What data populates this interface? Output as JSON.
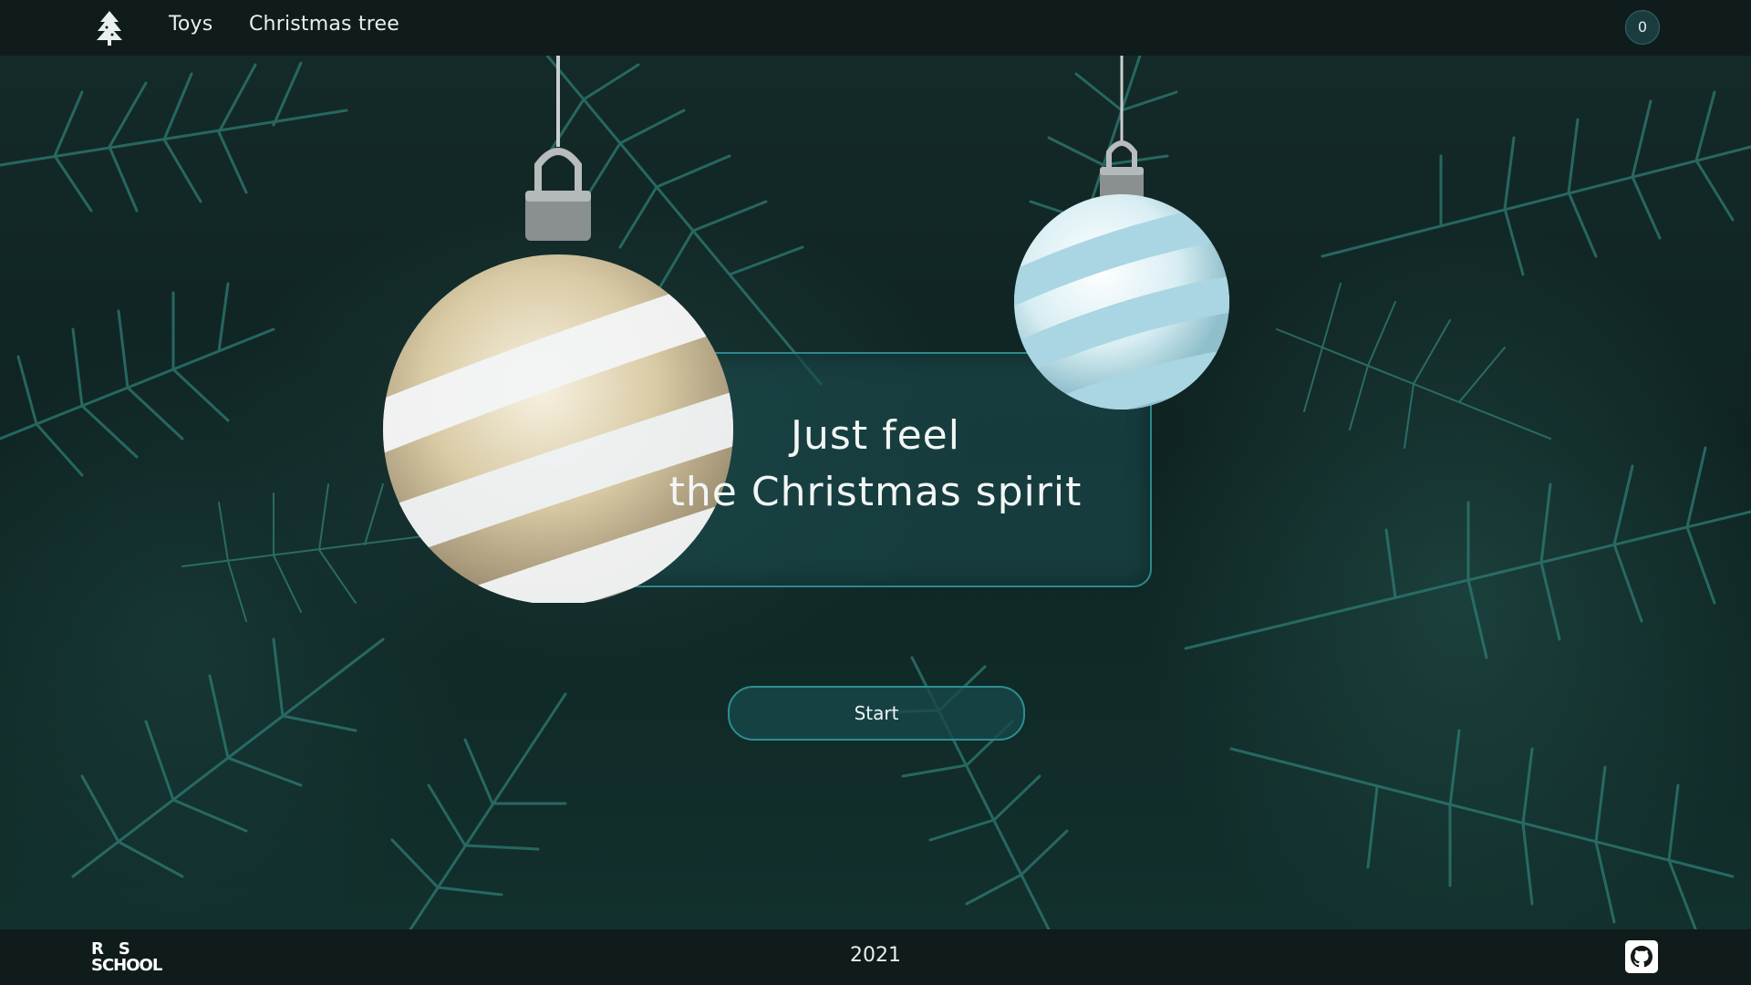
{
  "header": {
    "logo_icon": "christmas-tree-icon",
    "nav": [
      {
        "label": "Toys"
      },
      {
        "label": "Christmas tree"
      }
    ],
    "favorites_count": "0"
  },
  "hero": {
    "line1": "Just feel",
    "line2": "the Christmas spirit",
    "start_label": "Start"
  },
  "footer": {
    "rs_logo_top": "RS",
    "rs_logo_bottom": "SCHOOL",
    "year": "2021",
    "github_icon": "github-icon"
  },
  "colors": {
    "header_bg": "#0f1c1b",
    "accent_border": "#2b8a8c",
    "card_bg": "#1c4b4e",
    "text": "#f2f6f5"
  }
}
